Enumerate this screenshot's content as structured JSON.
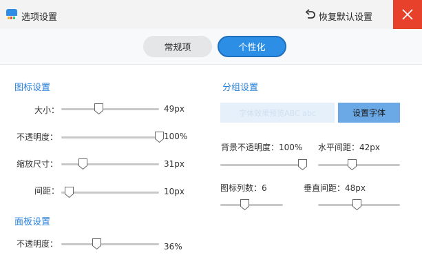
{
  "window": {
    "title": "选项设置",
    "reset_label": "恢复默认设置",
    "close_icon": "close-icon",
    "accent_color": "#2d8ee6",
    "close_color": "#e8412b"
  },
  "tabs": [
    {
      "label": "常规项",
      "active": false
    },
    {
      "label": "个性化",
      "active": true
    }
  ],
  "icon_settings": {
    "title": "图标设置",
    "rows": [
      {
        "label": "大小：",
        "value": "49px",
        "level": 0.38
      },
      {
        "label": "不透明度：",
        "value": "100%",
        "level": 1.0
      },
      {
        "label": "缩放尺寸：",
        "value": "31px",
        "level": 0.22
      },
      {
        "label": "间距：",
        "value": "10px",
        "level": 0.08
      }
    ]
  },
  "panel_settings": {
    "title": "面板设置",
    "rows": [
      {
        "label": "不透明度：",
        "value": "36%",
        "level": 0.36
      }
    ]
  },
  "group_settings": {
    "title": "分组设置",
    "font_preview": "字体效果预览ABC abc",
    "font_button": "设置字体",
    "bg_opacity": {
      "label": "背景不透明度：",
      "value": "100%",
      "level": 0.99
    },
    "h_spacing": {
      "label": "水平间距：",
      "value": "42px",
      "level": 0.41
    },
    "columns": {
      "label": "图标列数：",
      "value": "6",
      "level": 0.38
    },
    "v_spacing": {
      "label": "垂直间距：",
      "value": "48px",
      "level": 0.47
    }
  }
}
